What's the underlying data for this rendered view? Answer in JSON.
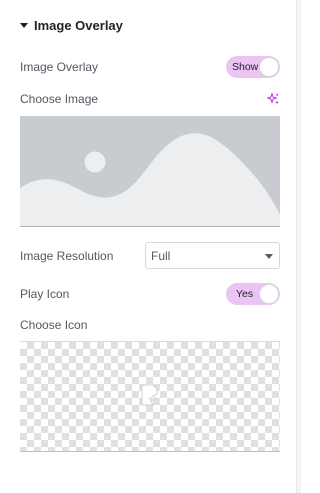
{
  "section": {
    "title": "Image Overlay"
  },
  "image_overlay": {
    "label": "Image Overlay",
    "toggle_label": "Show"
  },
  "choose_image": {
    "label": "Choose Image",
    "ai_icon": "sparkle-ai-icon"
  },
  "image_resolution": {
    "label": "Image Resolution",
    "value": "Full"
  },
  "play_icon": {
    "label": "Play Icon",
    "toggle_label": "Yes"
  },
  "choose_icon": {
    "label": "Choose Icon"
  },
  "colors": {
    "accent": "#ecc3f5",
    "ai_accent": "#c03ee0",
    "placeholder": "#c8ccd0"
  }
}
